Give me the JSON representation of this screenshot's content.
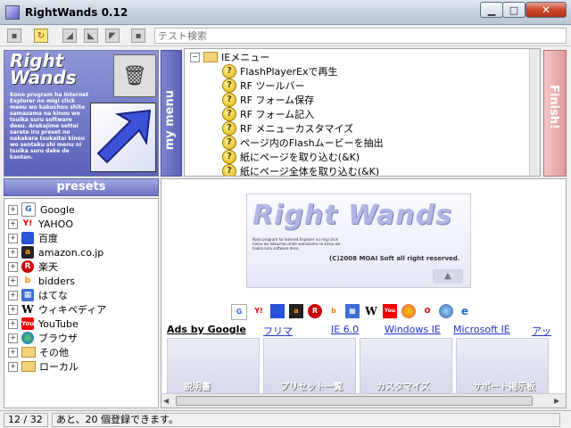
{
  "window": {
    "title": "RightWands 0.12"
  },
  "toolbar": {
    "search_placeholder": "テスト検索"
  },
  "logo": {
    "title_line1": "Right",
    "title_line2": "Wands",
    "description": "Kono program ha Internet Explorer no migi click menu wo kakuchou shite samazama na kinou wo tsuika suru software deeu. Arakajime settei sarete iru preset no nakakara tsukaitai kinou wo sentaku shi menu ni tsuika suru dake de kantan."
  },
  "side_tabs": {
    "my_menu": "my menu",
    "finish": "Finish!"
  },
  "menu_tree": {
    "root": "IEメニュー",
    "items": [
      "FlashPlayerExで再生",
      "RF ツールバー",
      "RF フォーム保存",
      "RF フォーム記入",
      "RF メニューカスタマイズ",
      "ページ内のFlashムービーを抽出",
      "紙にページを取り込む(&K)",
      "紙にページ全体を取り込む(&K)"
    ]
  },
  "presets": {
    "header": "presets",
    "items": [
      {
        "label": "Google",
        "icon": "google-icon"
      },
      {
        "label": "YAHOO",
        "icon": "yahoo-icon"
      },
      {
        "label": "百度",
        "icon": "baidu-icon"
      },
      {
        "label": "amazon.co.jp",
        "icon": "amazon-icon"
      },
      {
        "label": "楽天",
        "icon": "rakuten-icon"
      },
      {
        "label": "bidders",
        "icon": "bidders-icon"
      },
      {
        "label": "はてな",
        "icon": "hatena-icon"
      },
      {
        "label": "ウィキペディア",
        "icon": "wikipedia-icon"
      },
      {
        "label": "YouTube",
        "icon": "youtube-icon"
      },
      {
        "label": "ブラウザ",
        "icon": "browser-globe-icon"
      },
      {
        "label": "その他",
        "icon": "folder-icon"
      },
      {
        "label": "ローカル",
        "icon": "folder-icon"
      }
    ]
  },
  "browser": {
    "banner_title": "Right Wands",
    "banner_description": "Kono program ha Internet Explorer no migi click menu wo kakuchou shite samazama na kinou wo tsuika suru software desu.",
    "banner_copyright": "(C)2008 MOAI Soft all right reserved.",
    "ads_label": "Ads by Google",
    "ad_links": [
      "フリマ",
      "IE 6.0",
      "Windows IE",
      "Microsoft IE",
      "アッ"
    ],
    "tiles": [
      "説明書",
      "プリセット一覧",
      "カスタマイズ",
      "サポート掲示板"
    ]
  },
  "status": {
    "count": "12 / 32",
    "message": "あと、20 個登録できます。"
  }
}
